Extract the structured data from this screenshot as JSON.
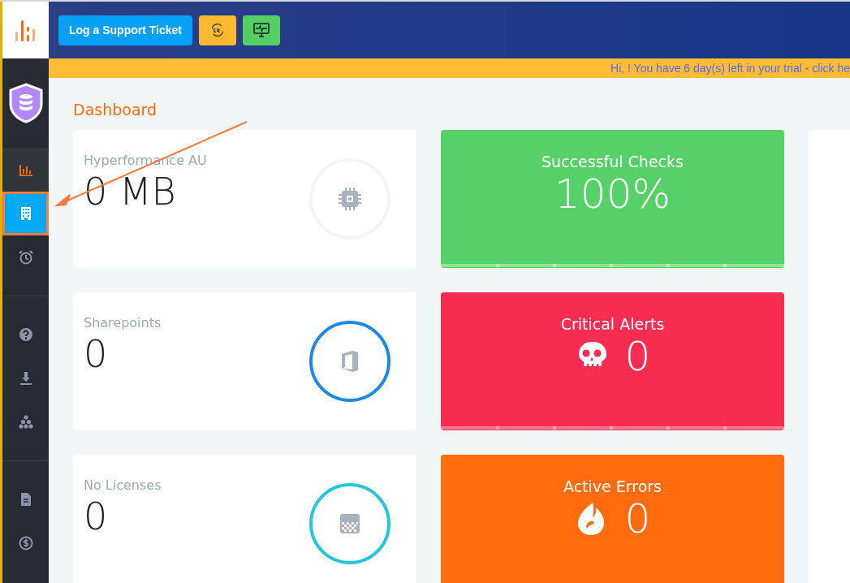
{
  "topbar": {
    "buttons": [
      {
        "kind": "text",
        "label": "Log a Support Ticket"
      },
      {
        "kind": "support24"
      },
      {
        "kind": "monitor"
      }
    ]
  },
  "banner": {
    "text": "Hi, ! You have 6 day(s) left in your trial - click he"
  },
  "sidebar": {
    "items": [
      {
        "selected": false,
        "highlighted": true,
        "annotated": false
      },
      {
        "selected": true,
        "highlighted": false,
        "annotated": true
      },
      {
        "selected": false,
        "highlighted": false,
        "annotated": false
      },
      {
        "selected": false,
        "highlighted": false,
        "annotated": false
      },
      {
        "selected": false,
        "highlighted": false,
        "annotated": false
      },
      {
        "selected": false,
        "highlighted": false,
        "annotated": false
      },
      {
        "selected": false,
        "highlighted": false,
        "annotated": false
      },
      {
        "selected": false,
        "highlighted": false,
        "annotated": false
      }
    ]
  },
  "page": {
    "title": "Dashboard"
  },
  "stat_cards": [
    {
      "label": "Hyperformance AU",
      "value": "0 MB",
      "color": "#f4f4f2"
    },
    {
      "label": "Sharepoints",
      "value": "0",
      "color": "#1e88e5"
    },
    {
      "label": "No Licenses",
      "value": "0",
      "color": "#26c6da"
    }
  ],
  "status_cards": [
    {
      "title": "Successful Checks",
      "value": "100%",
      "color": "#56d068"
    },
    {
      "title": "Critical Alerts",
      "value": "0",
      "color": "#f62d51"
    },
    {
      "title": "Active Errors",
      "value": "0",
      "color": "#ff6c0d"
    }
  ]
}
